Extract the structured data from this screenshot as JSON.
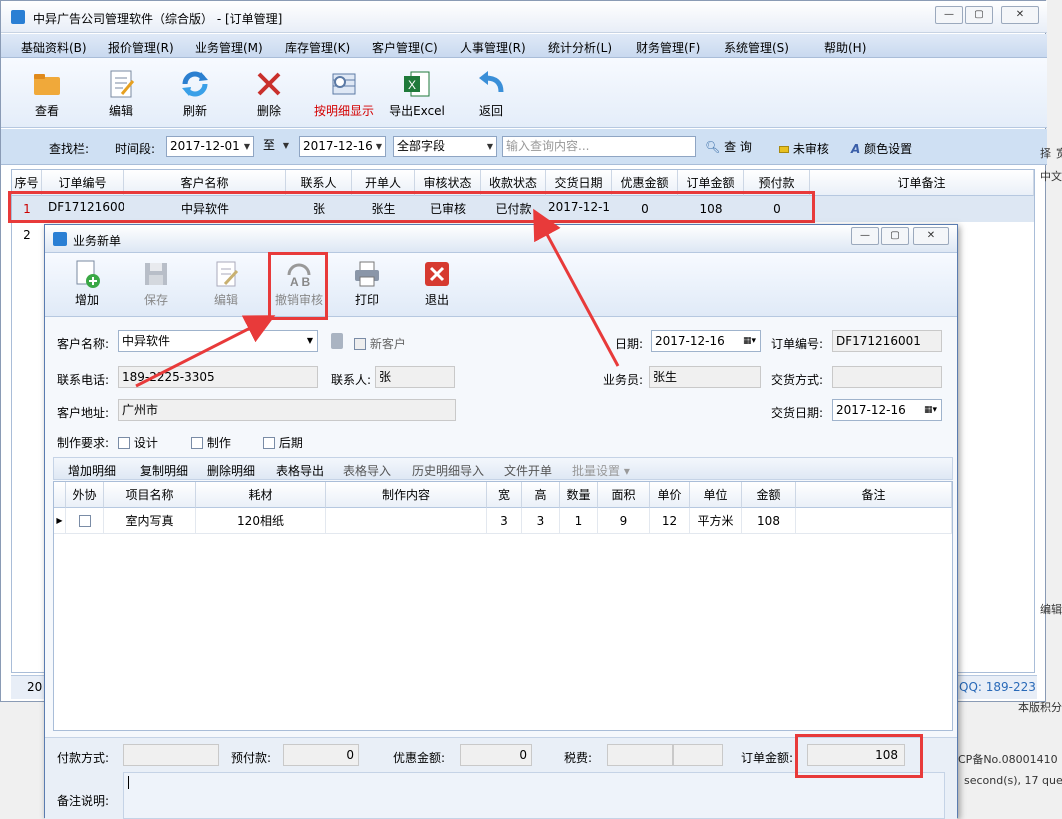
{
  "main_window": {
    "title": "中异广告公司管理软件（综合版） - [订单管理]",
    "menu": [
      "基础资料(B)",
      "报价管理(R)",
      "业务管理(M)",
      "库存管理(K)",
      "客户管理(C)",
      "人事管理(R)",
      "统计分析(L)",
      "财务管理(F)",
      "系统管理(S)",
      "帮助(H)"
    ],
    "toolbar": [
      {
        "label": "查看",
        "icon": "folder-icon"
      },
      {
        "label": "编辑",
        "icon": "edit-document-icon"
      },
      {
        "label": "刷新",
        "icon": "refresh-icon"
      },
      {
        "label": "删除",
        "icon": "delete-x-icon"
      },
      {
        "label": "按明细显示",
        "icon": "detail-view-icon",
        "color": "#d40000"
      },
      {
        "label": "导出Excel",
        "icon": "excel-icon"
      },
      {
        "label": "返回",
        "icon": "back-arrow-icon"
      }
    ],
    "search": {
      "bar_label": "查找栏:",
      "period_label": "时间段:",
      "date_from": "2017-12-01",
      "to_label": "至",
      "date_to": "2017-12-16",
      "field": "全部字段",
      "query_placeholder": "输入查询内容...",
      "query_button": "查 询",
      "unapproved_button": "未审核",
      "color_settings_button": "颜色设置"
    },
    "grid": {
      "headers": [
        "序号",
        "订单编号",
        "客户名称",
        "联系人",
        "开单人",
        "审核状态",
        "收款状态",
        "交货日期",
        "优惠金额",
        "订单金额",
        "预付款",
        "订单备注"
      ],
      "rows": [
        [
          "1",
          "DF17121600",
          "中异软件",
          "张",
          "张生",
          "已审核",
          "已付款",
          "2017-12-1",
          "0",
          "108",
          "0",
          ""
        ],
        [
          "2",
          "",
          "",
          "",
          "",
          "",
          "",
          "",
          "",
          "",
          "",
          ""
        ]
      ]
    },
    "status_left": "20",
    "status_right": "QQ: 189-223"
  },
  "right_fragments": [
    "择",
    "宽",
    "中文",
    "编辑",
    "本版积分",
    "CP备No.08001410",
    "second(s), 17 que"
  ],
  "dialog": {
    "title": "业务新单",
    "toolbar": [
      {
        "label": "增加",
        "icon": "add-document-icon",
        "enabled": true
      },
      {
        "label": "保存",
        "icon": "save-icon",
        "enabled": false
      },
      {
        "label": "编辑",
        "icon": "edit-icon",
        "enabled": false
      },
      {
        "label": "撤销审核",
        "icon": "revoke-approval-icon",
        "enabled": false
      },
      {
        "label": "打印",
        "icon": "printer-icon",
        "enabled": true
      },
      {
        "label": "退出",
        "icon": "exit-icon",
        "enabled": true
      }
    ],
    "form": {
      "customer_name_label": "客户名称:",
      "customer_name": "中异软件",
      "new_customer_label": "新客户",
      "date_label": "日期:",
      "date": "2017-12-16",
      "order_no_label": "订单编号:",
      "order_no": "DF171216001",
      "phone_label": "联系电话:",
      "phone": "189-2225-3305",
      "contact_label": "联系人:",
      "contact": "张",
      "salesperson_label": "业务员:",
      "salesperson": "张生",
      "delivery_method_label": "交货方式:",
      "delivery_method": "",
      "address_label": "客户地址:",
      "address": "广州市",
      "delivery_date_label": "交货日期:",
      "delivery_date": "2017-12-16",
      "requirement_label": "制作要求:",
      "req_design": "设计",
      "req_make": "制作",
      "req_post": "后期"
    },
    "subtoolbar": [
      "增加明细",
      "复制明细",
      "删除明细",
      "表格导出",
      "表格导入",
      "历史明细导入",
      "文件开单",
      "批量设置 ▾"
    ],
    "detail_grid": {
      "headers": [
        "外协",
        "项目名称",
        "耗材",
        "制作内容",
        "宽",
        "高",
        "数量",
        "面积",
        "单价",
        "单位",
        "金额",
        "备注"
      ],
      "row": [
        "",
        "室内写真",
        "120相纸",
        "",
        "3",
        "3",
        "1",
        "9",
        "12",
        "平方米",
        "108",
        ""
      ]
    },
    "footer": {
      "payment_method_label": "付款方式:",
      "payment_method": "",
      "prepay_label": "预付款:",
      "prepay": "0",
      "discount_label": "优惠金额:",
      "discount": "0",
      "tax_label": "税费:",
      "order_amount_label": "订单金额:",
      "order_amount": "108",
      "remark_label": "备注说明:"
    }
  },
  "colors": {
    "annotation_red": "#e83a3a",
    "highlight_row": "#dde7f3"
  }
}
